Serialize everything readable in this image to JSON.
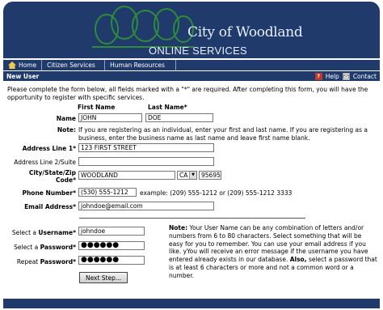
{
  "header": {
    "city_title": "City of Woodland",
    "subtitle": "ONLINE SERVICES"
  },
  "nav": {
    "items": [
      "Home",
      "Citizen Services",
      "Human Resources"
    ]
  },
  "subbar": {
    "title": "New User",
    "help_label": "Help",
    "contact_label": "Contact",
    "help_icon": "question-icon",
    "contact_icon": "mail-icon"
  },
  "intro": "Please complete the form below, all fields marked with a \"*\" are required. After completing this form, you will have the opportunity to register with specific services.",
  "form": {
    "first_name_header": "First Name",
    "last_name_header": "Last Name*",
    "name_label": "Name",
    "first_name_value": "JOHN",
    "last_name_value": "DOE",
    "note_label": "Note:",
    "note_text": "If you are registering as an individual, enter your first and last name. If you are registering as a business, enter the business name as last name and leave first name blank.",
    "address1_label": "Address Line 1*",
    "address1_value": "123 FIRST STREET",
    "address2_label": "Address Line 2/Suite",
    "address2_value": "",
    "csz_label_1": "City/State/Zip",
    "csz_label_2": "Code*",
    "city_value": "WOODLAND",
    "state_value": "CA",
    "zip_value": "95695",
    "phone_label": "Phone Number*",
    "phone_value": "(530) 555-1212",
    "phone_example": "example: (209) 555-1212 or (209) 555-1212 3333",
    "email_label": "Email Address*",
    "email_value": "johndoe@email.com",
    "username_label_pre": "Select a ",
    "username_label_bold": "Username",
    "username_value": "johndoe",
    "password_label_pre": "Select a ",
    "password_label_bold": "Password",
    "password_value": "●●●●●●",
    "repeat_label_pre": "Repeat ",
    "repeat_label_bold": "Password",
    "repeat_value": "●●●●●●",
    "username_note_bold": "Note:",
    "username_note_text": "Your User Name can be any combination of letters and/or numbers from 6 to 80 characters. Select something that will be easy for you to remember. You can use your email address if you like. yYou will receive an error message if the username you have entered already exists in our database.",
    "also_bold": "Also,",
    "also_text": "select a password that is at least 6 characters or more and not a common word or a number.",
    "next_button": "Next Step..."
  },
  "colors": {
    "header_bg": "#1f3a6b",
    "header_text": "#e8f0ff"
  }
}
